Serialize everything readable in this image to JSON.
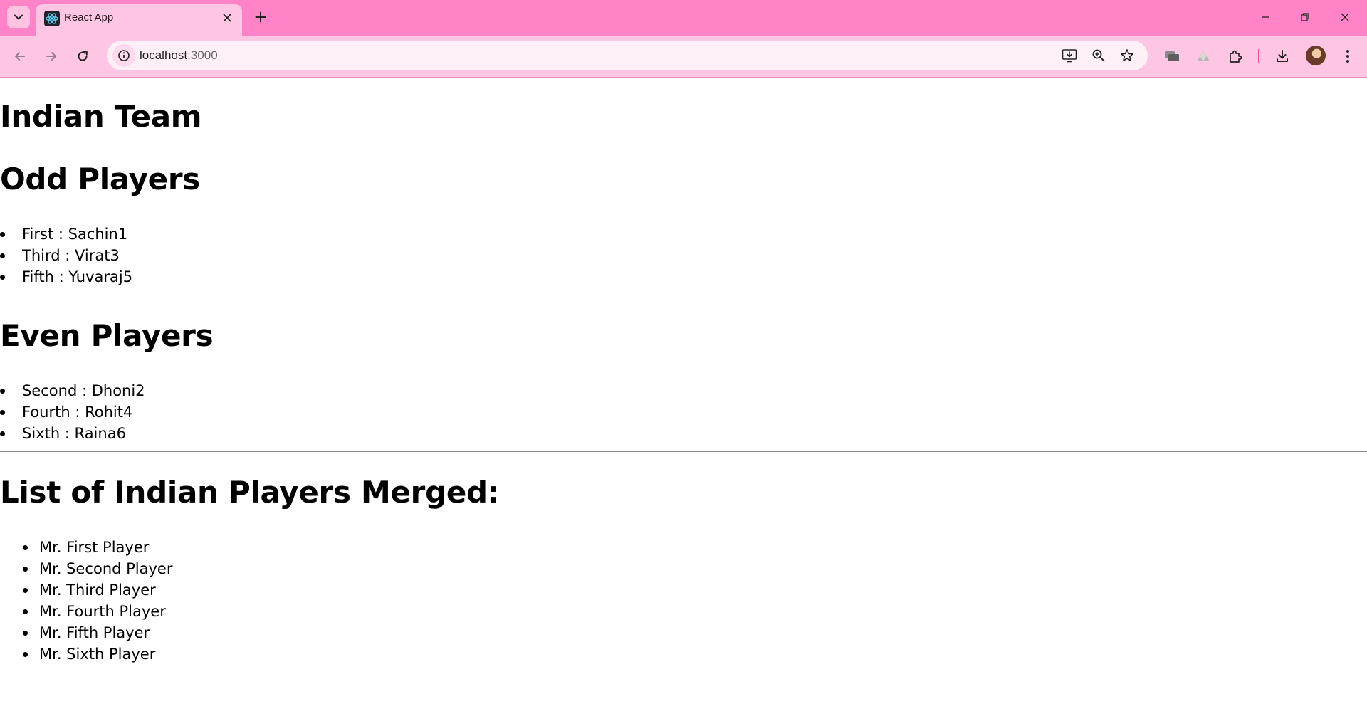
{
  "browser": {
    "tab": {
      "title": "React App"
    },
    "address_bar": {
      "host": "localhost",
      "port": ":3000"
    }
  },
  "page": {
    "title": "Indian Team",
    "odd_section": {
      "heading": "Odd Players",
      "items": [
        "First : Sachin1",
        "Third : Virat3",
        "Fifth : Yuvaraj5"
      ]
    },
    "even_section": {
      "heading": "Even Players",
      "items": [
        "Second : Dhoni2",
        "Fourth : Rohit4",
        "Sixth : Raina6"
      ]
    },
    "merged_section": {
      "heading": "List of Indian Players Merged:",
      "items": [
        "Mr. First Player",
        "Mr. Second Player",
        "Mr. Third Player",
        "Mr. Fourth Player",
        "Mr. Fifth Player",
        "Mr. Sixth Player"
      ]
    }
  },
  "icons": {
    "tab_search": "chevron-down-icon",
    "favicon": "react-logo-icon",
    "close": "close-icon",
    "new_tab": "plus-icon",
    "back": "back-arrow-icon",
    "forward": "forward-arrow-icon",
    "reload": "reload-icon",
    "site_info": "info-icon",
    "install": "install-app-icon",
    "zoom": "zoom-icon",
    "bookmark": "star-icon",
    "extensions": "puzzle-icon",
    "downloads": "download-icon",
    "menu": "kebab-menu-icon"
  },
  "colors": {
    "tabstrip": "#ff83c6",
    "toolbar": "#ffc6e3",
    "omnibox": "#fff0f8"
  }
}
